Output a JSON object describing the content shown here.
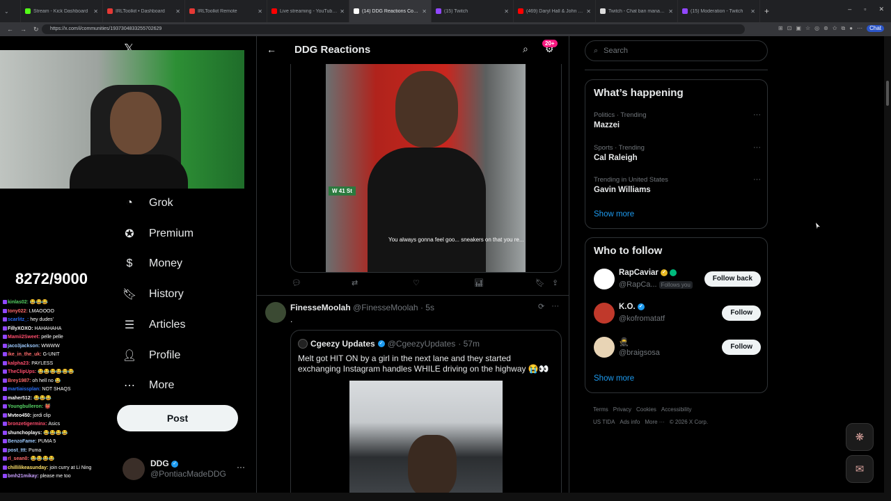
{
  "browser": {
    "tabs": [
      {
        "label": "Stream - Kick Dashboard",
        "color": "#53fc18",
        "active": false
      },
      {
        "label": "IRLToolkit • Dashboard",
        "color": "#e53935",
        "active": false
      },
      {
        "label": "IRLToolkit Remote",
        "color": "#e53935",
        "active": false
      },
      {
        "label": "Live streaming - YouTube Studio",
        "color": "#ff0000",
        "active": false
      },
      {
        "label": "(14) DDG Reactions Community / X",
        "color": "#ffffff",
        "active": true
      },
      {
        "label": "(15) Twitch",
        "color": "#9147ff",
        "active": false
      },
      {
        "label": "(469) Daryl Hall & John Oates",
        "color": "#ff0000",
        "active": false
      },
      {
        "label": "Twitch - Chat ban manager",
        "color": "#dddddd",
        "active": false
      },
      {
        "label": "(15) Moderation - Twitch",
        "color": "#9147ff",
        "active": false
      }
    ],
    "url": "https://x.com/i/communities/1937304833255702629",
    "chat_label": "Chat"
  },
  "stream": {
    "counter": "8272/9000",
    "chat": [
      {
        "user": "kinlas02:",
        "msg": "😂😂😂",
        "color": "#56d364"
      },
      {
        "user": "tony022:",
        "msg": "LMAOOOO",
        "color": "#ff6b6b"
      },
      {
        "user": "scarlitz_:",
        "msg": "hey dudes'",
        "color": "#2a6df4"
      },
      {
        "user": "FillyXOXO:",
        "msg": "HAHAHAHA",
        "color": "#ffffff"
      },
      {
        "user": "Mamii2Sweet:",
        "msg": "pelle pelle",
        "color": "#ff4d6d"
      },
      {
        "user": "jaco3jackson:",
        "msg": "WWWW",
        "color": "#9ecbff"
      },
      {
        "user": "ike_in_the_uk:",
        "msg": "G-UNIT",
        "color": "#ff6b6b"
      },
      {
        "user": "kalpha23:",
        "msg": "PAYLESS",
        "color": "#ff4d6d"
      },
      {
        "user": "TheClipUps:",
        "msg": "😂😂😂😂😂😂",
        "color": "#ff4d6d"
      },
      {
        "user": "Brey1987:",
        "msg": "oh hell no 😂",
        "color": "#ff6b6b"
      },
      {
        "user": "martiaissplan:",
        "msg": "NOT SHAQS",
        "color": "#2a6df4"
      },
      {
        "user": "maher512:",
        "msg": "😂😂😂",
        "color": "#ffffff"
      },
      {
        "user": "Youngbulleron:",
        "msg": "👹",
        "color": "#56d364"
      },
      {
        "user": "Mvteo450:",
        "msg": "jordi clip",
        "color": "#ffffff"
      },
      {
        "user": "bronzetigerminx:",
        "msg": "Asics",
        "color": "#ff4d6d"
      },
      {
        "user": "shunchoplays:",
        "msg": "😂😂😂😂",
        "color": "#ffffff"
      },
      {
        "user": "BenzoFame:",
        "msg": "PUMA 5",
        "color": "#9ecbff"
      },
      {
        "user": "post_ttt:",
        "msg": "Puma",
        "color": "#9ecbff"
      },
      {
        "user": "rl_sean0:",
        "msg": "😂😂😂😂",
        "color": "#ff6b6b"
      },
      {
        "user": "chillilikeasunday:",
        "msg": "join curry at Li Ning",
        "color": "#ffe26b"
      },
      {
        "user": "bmh21mikay:",
        "msg": "please me too",
        "color": "#c9a0ff"
      }
    ]
  },
  "nav": {
    "items": [
      {
        "label": "Grok",
        "icon": "grok-icon"
      },
      {
        "label": "Premium",
        "icon": "premium-icon"
      },
      {
        "label": "Money",
        "icon": "money-icon"
      },
      {
        "label": "History",
        "icon": "bookmark-icon"
      },
      {
        "label": "Articles",
        "icon": "articles-icon"
      },
      {
        "label": "Profile",
        "icon": "profile-icon"
      },
      {
        "label": "More",
        "icon": "more-icon"
      }
    ],
    "post_label": "Post",
    "account": {
      "name": "DDG",
      "handle": "@PontiacMadeDDG"
    }
  },
  "main": {
    "title": "DDG Reactions",
    "badge": "20+",
    "media1": {
      "sign": "W 41 St",
      "caption": "You always gonna feel goo... sneakers on that you re..."
    },
    "tweet2": {
      "name": "FinesseMoolah",
      "handle": "@FinesseMoolah",
      "time": "· 5s",
      "text": ".",
      "quote": {
        "name": "Cgeezy Updates",
        "handle": "@CgeezyUpdates",
        "time": "· 57m",
        "text": "Melt got HIT ON by a girl in the next lane and they started exchanging Instagram handles WHILE driving on the highway 😭👀"
      }
    }
  },
  "right": {
    "search_placeholder": "Search",
    "happening": {
      "title": "What’s happening",
      "trends": [
        {
          "meta": "Politics · Trending",
          "name": "Mazzei"
        },
        {
          "meta": "Sports · Trending",
          "name": "Cal Raleigh"
        },
        {
          "meta": "Trending in United States",
          "name": "Gavin Williams"
        }
      ],
      "show_more": "Show more"
    },
    "who_to_follow": {
      "title": "Who to follow",
      "people": [
        {
          "name": "RapCaviar",
          "handle": "@RapCa...",
          "follows_you": "Follows you",
          "button": "Follow back",
          "avatar": "#ffffff"
        },
        {
          "name": "K.O.",
          "handle": "@kofromatatf",
          "follows_you": "",
          "button": "Follow",
          "avatar": "#c0392b"
        },
        {
          "name": "🥷",
          "handle": "@braigsosa",
          "follows_you": "",
          "button": "Follow",
          "avatar": "#e8d4b5"
        }
      ],
      "show_more": "Show more"
    },
    "footer": [
      "Terms",
      "Privacy",
      "Cookies",
      "Accessibility",
      "US TIDA",
      "Ads info",
      "More ···",
      "© 2026 X Corp."
    ]
  }
}
